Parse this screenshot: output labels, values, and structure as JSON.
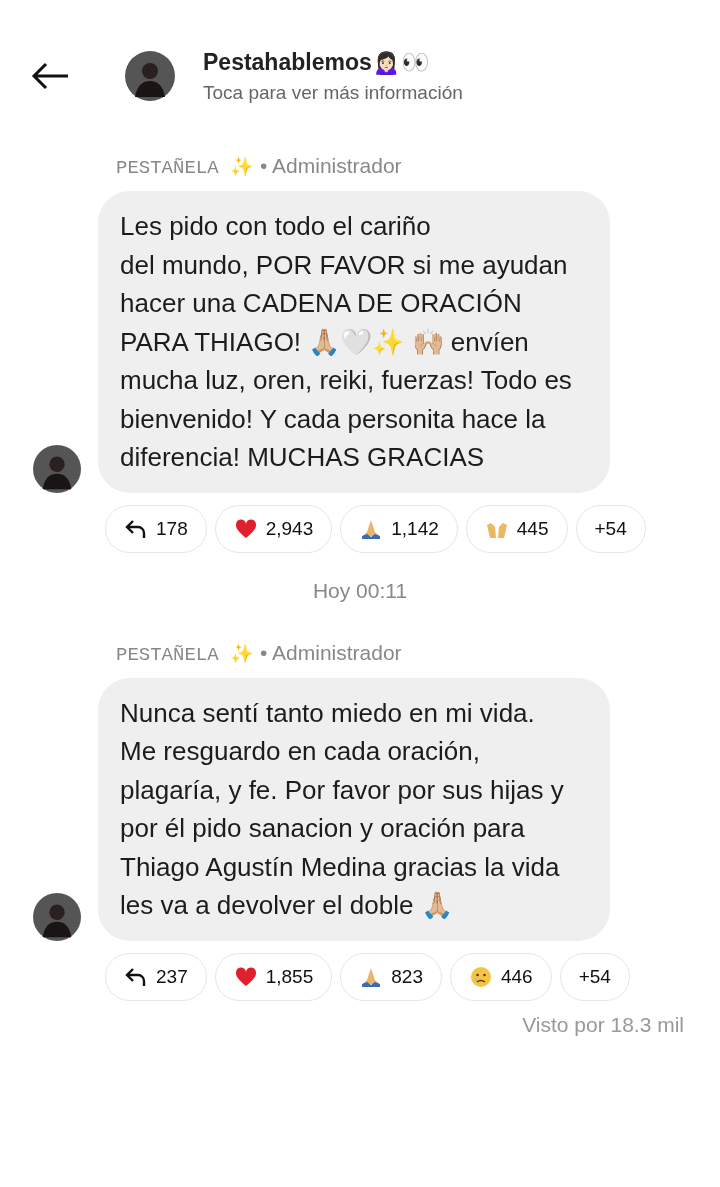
{
  "header": {
    "title": "Pestahablemos🙍🏻‍♀️👀",
    "subtitle": "Toca para ver más información"
  },
  "messages": [
    {
      "sender": "PESTAÑELA ✨",
      "role": "• Administrador",
      "text": "Les pido con todo el cariño\ndel mundo, POR FAVOR si me ayudan hacer una CADENA DE ORACIÓN PARA THIAGO! 🙏🏼🤍✨ 🙌🏼 envíen mucha luz, oren, reiki, fuerzas! Todo es bienvenido! Y cada personita hace la diferencia! MUCHAS GRACIAS",
      "reactions": [
        {
          "kind": "reply",
          "count": "178"
        },
        {
          "kind": "heart",
          "count": "2,943"
        },
        {
          "kind": "pray",
          "count": "1,142"
        },
        {
          "kind": "raised",
          "count": "445"
        },
        {
          "kind": "more",
          "count": "+54"
        }
      ]
    },
    {
      "date": "Hoy 00:11",
      "sender": "PESTAÑELA ✨",
      "role": "• Administrador",
      "text": "Nunca sentí tanto miedo en mi vida.\nMe resguardo en cada oración, plagaría, y fe. Por favor por sus hijas y por él pido sanacion y oración para Thiago Agustín Medina gracias la vida les va a devolver el doble 🙏🏼",
      "reactions": [
        {
          "kind": "reply",
          "count": "237"
        },
        {
          "kind": "heart",
          "count": "1,855"
        },
        {
          "kind": "pray",
          "count": "823"
        },
        {
          "kind": "sad",
          "count": "446"
        },
        {
          "kind": "more",
          "count": "+54"
        }
      ]
    }
  ],
  "seen": "Visto por 18.3 mil"
}
